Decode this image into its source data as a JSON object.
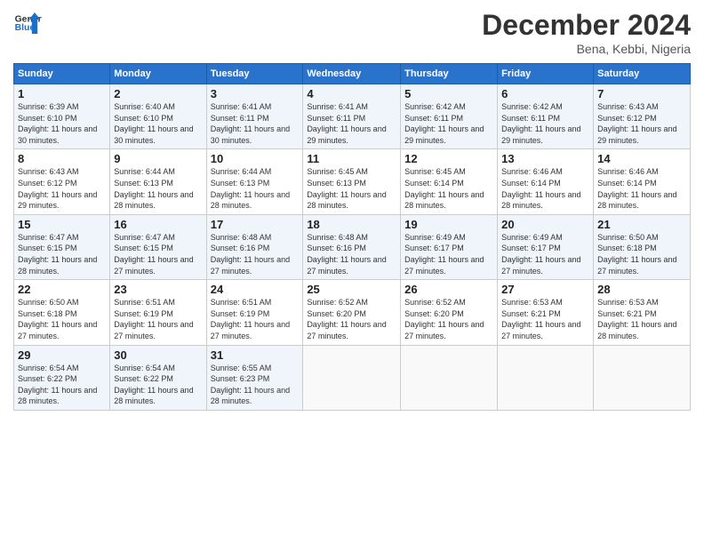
{
  "header": {
    "logo_line1": "General",
    "logo_line2": "Blue",
    "month": "December 2024",
    "location": "Bena, Kebbi, Nigeria"
  },
  "days_of_week": [
    "Sunday",
    "Monday",
    "Tuesday",
    "Wednesday",
    "Thursday",
    "Friday",
    "Saturday"
  ],
  "weeks": [
    [
      {
        "day": "1",
        "sunrise": "6:39 AM",
        "sunset": "6:10 PM",
        "daylight": "11 hours and 30 minutes."
      },
      {
        "day": "2",
        "sunrise": "6:40 AM",
        "sunset": "6:10 PM",
        "daylight": "11 hours and 30 minutes."
      },
      {
        "day": "3",
        "sunrise": "6:41 AM",
        "sunset": "6:11 PM",
        "daylight": "11 hours and 30 minutes."
      },
      {
        "day": "4",
        "sunrise": "6:41 AM",
        "sunset": "6:11 PM",
        "daylight": "11 hours and 29 minutes."
      },
      {
        "day": "5",
        "sunrise": "6:42 AM",
        "sunset": "6:11 PM",
        "daylight": "11 hours and 29 minutes."
      },
      {
        "day": "6",
        "sunrise": "6:42 AM",
        "sunset": "6:11 PM",
        "daylight": "11 hours and 29 minutes."
      },
      {
        "day": "7",
        "sunrise": "6:43 AM",
        "sunset": "6:12 PM",
        "daylight": "11 hours and 29 minutes."
      }
    ],
    [
      {
        "day": "8",
        "sunrise": "6:43 AM",
        "sunset": "6:12 PM",
        "daylight": "11 hours and 29 minutes."
      },
      {
        "day": "9",
        "sunrise": "6:44 AM",
        "sunset": "6:13 PM",
        "daylight": "11 hours and 28 minutes."
      },
      {
        "day": "10",
        "sunrise": "6:44 AM",
        "sunset": "6:13 PM",
        "daylight": "11 hours and 28 minutes."
      },
      {
        "day": "11",
        "sunrise": "6:45 AM",
        "sunset": "6:13 PM",
        "daylight": "11 hours and 28 minutes."
      },
      {
        "day": "12",
        "sunrise": "6:45 AM",
        "sunset": "6:14 PM",
        "daylight": "11 hours and 28 minutes."
      },
      {
        "day": "13",
        "sunrise": "6:46 AM",
        "sunset": "6:14 PM",
        "daylight": "11 hours and 28 minutes."
      },
      {
        "day": "14",
        "sunrise": "6:46 AM",
        "sunset": "6:14 PM",
        "daylight": "11 hours and 28 minutes."
      }
    ],
    [
      {
        "day": "15",
        "sunrise": "6:47 AM",
        "sunset": "6:15 PM",
        "daylight": "11 hours and 28 minutes."
      },
      {
        "day": "16",
        "sunrise": "6:47 AM",
        "sunset": "6:15 PM",
        "daylight": "11 hours and 27 minutes."
      },
      {
        "day": "17",
        "sunrise": "6:48 AM",
        "sunset": "6:16 PM",
        "daylight": "11 hours and 27 minutes."
      },
      {
        "day": "18",
        "sunrise": "6:48 AM",
        "sunset": "6:16 PM",
        "daylight": "11 hours and 27 minutes."
      },
      {
        "day": "19",
        "sunrise": "6:49 AM",
        "sunset": "6:17 PM",
        "daylight": "11 hours and 27 minutes."
      },
      {
        "day": "20",
        "sunrise": "6:49 AM",
        "sunset": "6:17 PM",
        "daylight": "11 hours and 27 minutes."
      },
      {
        "day": "21",
        "sunrise": "6:50 AM",
        "sunset": "6:18 PM",
        "daylight": "11 hours and 27 minutes."
      }
    ],
    [
      {
        "day": "22",
        "sunrise": "6:50 AM",
        "sunset": "6:18 PM",
        "daylight": "11 hours and 27 minutes."
      },
      {
        "day": "23",
        "sunrise": "6:51 AM",
        "sunset": "6:19 PM",
        "daylight": "11 hours and 27 minutes."
      },
      {
        "day": "24",
        "sunrise": "6:51 AM",
        "sunset": "6:19 PM",
        "daylight": "11 hours and 27 minutes."
      },
      {
        "day": "25",
        "sunrise": "6:52 AM",
        "sunset": "6:20 PM",
        "daylight": "11 hours and 27 minutes."
      },
      {
        "day": "26",
        "sunrise": "6:52 AM",
        "sunset": "6:20 PM",
        "daylight": "11 hours and 27 minutes."
      },
      {
        "day": "27",
        "sunrise": "6:53 AM",
        "sunset": "6:21 PM",
        "daylight": "11 hours and 27 minutes."
      },
      {
        "day": "28",
        "sunrise": "6:53 AM",
        "sunset": "6:21 PM",
        "daylight": "11 hours and 28 minutes."
      }
    ],
    [
      {
        "day": "29",
        "sunrise": "6:54 AM",
        "sunset": "6:22 PM",
        "daylight": "11 hours and 28 minutes."
      },
      {
        "day": "30",
        "sunrise": "6:54 AM",
        "sunset": "6:22 PM",
        "daylight": "11 hours and 28 minutes."
      },
      {
        "day": "31",
        "sunrise": "6:55 AM",
        "sunset": "6:23 PM",
        "daylight": "11 hours and 28 minutes."
      },
      null,
      null,
      null,
      null
    ]
  ]
}
